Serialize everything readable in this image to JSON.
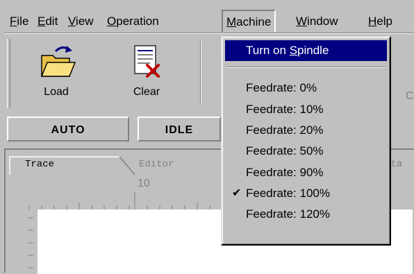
{
  "menubar": {
    "items": [
      {
        "label": "File",
        "mnemonic": "F",
        "rest": "ile"
      },
      {
        "label": "Edit",
        "mnemonic": "E",
        "rest": "dit"
      },
      {
        "label": "View",
        "mnemonic": "V",
        "rest": "iew"
      },
      {
        "label": "Operation",
        "mnemonic": "O",
        "rest": "peration"
      },
      {
        "label": "Machine",
        "mnemonic": "M",
        "rest": "achine"
      },
      {
        "label": "Window",
        "mnemonic": "W",
        "rest": "indow"
      },
      {
        "label": "Help",
        "mnemonic": "H",
        "rest": "elp"
      }
    ]
  },
  "toolbar": {
    "load_label": "Load",
    "clear_label": "Clear",
    "partial_label": "C"
  },
  "status": {
    "mode": "AUTO",
    "state": "IDLE"
  },
  "tabs": {
    "trace": "Trace",
    "editor": "Editor",
    "partial": "Sta"
  },
  "ruler": {
    "mark": "10"
  },
  "machine_menu": {
    "spindle_pre": "Turn on ",
    "spindle_mnemonic": "S",
    "spindle_post": "pindle",
    "feedrates": [
      {
        "label": "Feedrate: 0%",
        "checked": false
      },
      {
        "label": "Feedrate: 10%",
        "checked": false
      },
      {
        "label": "Feedrate: 20%",
        "checked": false
      },
      {
        "label": "Feedrate: 50%",
        "checked": false
      },
      {
        "label": "Feedrate: 90%",
        "checked": false
      },
      {
        "label": "Feedrate: 100%",
        "checked": true
      },
      {
        "label": "Feedrate: 120%",
        "checked": false
      }
    ],
    "check_glyph": "✔"
  },
  "colors": {
    "highlight": "#000080",
    "face": "#c0c0c0"
  }
}
